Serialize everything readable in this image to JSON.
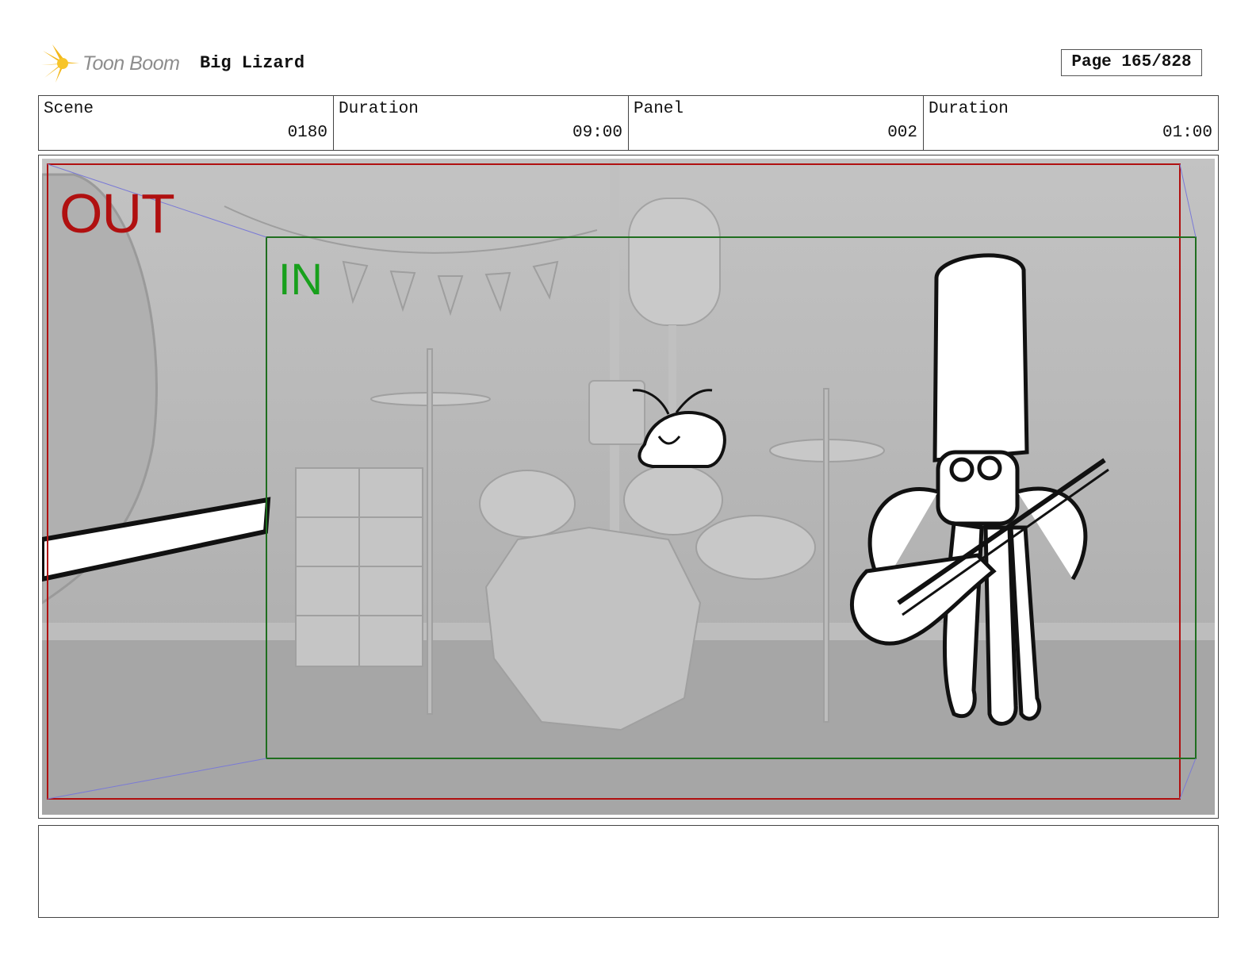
{
  "header": {
    "logo_text": "Toon Boom",
    "project_title": "Big Lizard",
    "page_label": "Page 165/828"
  },
  "info": {
    "scene_label": "Scene",
    "scene_value": "0180",
    "scene_duration_label": "Duration",
    "scene_duration_value": "09:00",
    "panel_label": "Panel",
    "panel_value": "002",
    "panel_duration_label": "Duration",
    "panel_duration_value": "01:00"
  },
  "panel": {
    "out_label": "OUT",
    "in_label": "IN",
    "colors": {
      "out_frame": "#b01010",
      "in_frame": "#1f6e1f",
      "background": "#b4b4b4"
    }
  },
  "notes": {
    "text": ""
  }
}
